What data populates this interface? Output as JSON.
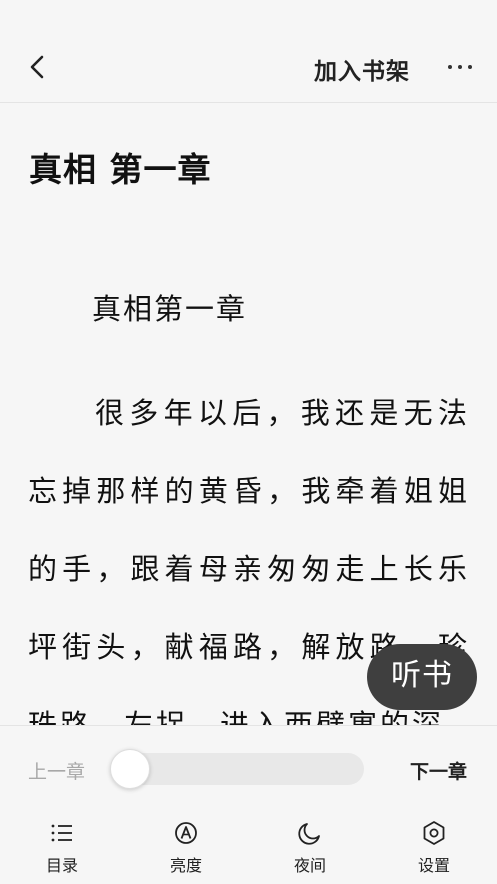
{
  "header": {
    "add_to_shelf_label": "加入书架"
  },
  "reader": {
    "chapter_title": "真相 第一章",
    "section_heading": "真相第一章",
    "body_text": "很多年以后，我还是无法忘掉那样的黄昏，我牵着姐姐的手，跟着母亲匆匆走上长乐坪街头，献福路，解放路，珍珠路，左拐，进入西壁寓的深"
  },
  "floating": {
    "listen_label": "听书"
  },
  "footer": {
    "prev_chapter_label": "上一章",
    "next_chapter_label": "下一章",
    "progress_fraction": 0,
    "nav": [
      {
        "label": "目录",
        "icon": "list-icon"
      },
      {
        "label": "亮度",
        "icon": "brightness-icon"
      },
      {
        "label": "夜间",
        "icon": "moon-icon"
      },
      {
        "label": "设置",
        "icon": "settings-icon"
      }
    ]
  }
}
